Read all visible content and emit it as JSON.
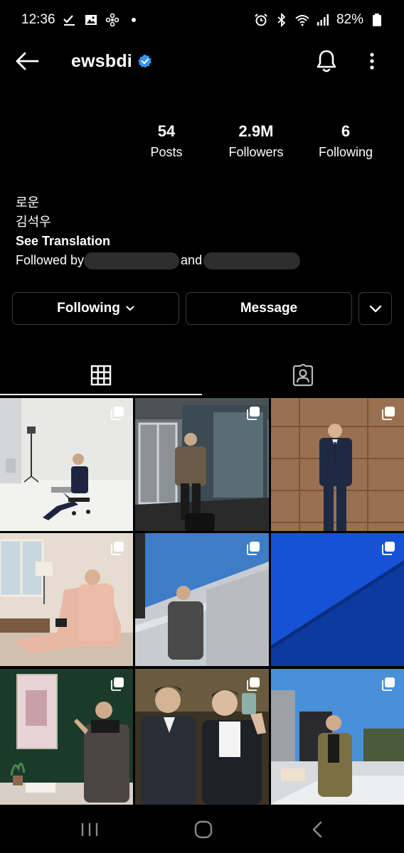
{
  "status_bar": {
    "time": "12:36",
    "battery": "82%",
    "left_icons": [
      "check-download-icon",
      "image-icon",
      "pinwheel-icon",
      "dot-icon"
    ],
    "right_icons": [
      "alarm-icon",
      "bluetooth-icon",
      "wifi-icon",
      "signal-icon",
      "battery-icon"
    ]
  },
  "header": {
    "username": "ewsbdi",
    "verified": true,
    "verified_color": "#3897f0"
  },
  "stats": [
    {
      "value": "54",
      "label": "Posts"
    },
    {
      "value": "2.9M",
      "label": "Followers"
    },
    {
      "value": "6",
      "label": "Following"
    }
  ],
  "bio": {
    "line1": "로운",
    "line2": "김석우",
    "see_translation": "See Translation",
    "followed_by": "Followed by",
    "and": "and"
  },
  "actions": {
    "following": "Following",
    "message": "Message"
  },
  "tabs": [
    {
      "icon": "grid-icon",
      "active": true
    },
    {
      "icon": "tagged-icon",
      "active": false
    }
  ],
  "posts": [
    {
      "multiple": true
    },
    {
      "multiple": true
    },
    {
      "multiple": true
    },
    {
      "multiple": true
    },
    {
      "multiple": true
    },
    {
      "multiple": true
    },
    {
      "multiple": true
    },
    {
      "multiple": true
    },
    {
      "multiple": true
    }
  ],
  "nav_icons": [
    "recents-icon",
    "home-icon",
    "back-icon"
  ],
  "colors": {
    "background": "#000000",
    "button_border": "#3a3a3a",
    "redacted": "#2e2e2e"
  }
}
